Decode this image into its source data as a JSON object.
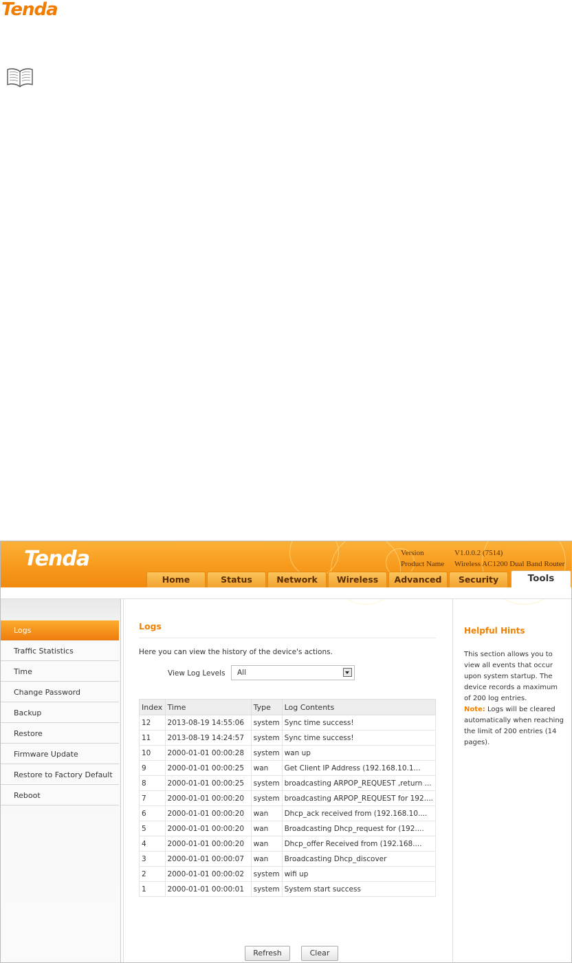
{
  "document": {
    "logo_text": "Tenda"
  },
  "app": {
    "brand": "Tenda",
    "version_label": "Version",
    "version_value": "V1.0.0.2 (7514)",
    "product_label": "Product Name",
    "product_value": "Wireless AC1200 Dual Band Router",
    "accent_color": "#f08000"
  },
  "tabs": [
    {
      "label": "Home"
    },
    {
      "label": "Status"
    },
    {
      "label": "Network"
    },
    {
      "label": "Wireless"
    },
    {
      "label": "Advanced"
    },
    {
      "label": "Security"
    },
    {
      "label": "Tools",
      "active": true
    }
  ],
  "sidebar": {
    "items": [
      {
        "label": "Logs",
        "active": true
      },
      {
        "label": "Traffic Statistics"
      },
      {
        "label": "Time"
      },
      {
        "label": "Change Password"
      },
      {
        "label": "Backup"
      },
      {
        "label": "Restore"
      },
      {
        "label": "Firmware Update"
      },
      {
        "label": "Restore to Factory Default"
      },
      {
        "label": "Reboot"
      }
    ]
  },
  "main": {
    "title": "Logs",
    "intro": "Here you can view the history of the device's actions.",
    "level_label": "View Log Levels",
    "level_value": "All",
    "columns": [
      "Index",
      "Time",
      "Type",
      "Log Contents"
    ],
    "rows": [
      [
        "12",
        "2013-08-19 14:55:06",
        "system",
        "Sync time success!"
      ],
      [
        "11",
        "2013-08-19 14:24:57",
        "system",
        "Sync time success!"
      ],
      [
        "10",
        "2000-01-01 00:00:28",
        "system",
        "wan up"
      ],
      [
        "9",
        "2000-01-01 00:00:25",
        "wan",
        "Get Client IP Address (192.168.10.1..."
      ],
      [
        "8",
        "2000-01-01 00:00:25",
        "system",
        "broadcasting ARPOP_REQUEST ,return ..."
      ],
      [
        "7",
        "2000-01-01 00:00:20",
        "system",
        "broadcasting ARPOP_REQUEST for 192...."
      ],
      [
        "6",
        "2000-01-01 00:00:20",
        "wan",
        "Dhcp_ack received from (192.168.10...."
      ],
      [
        "5",
        "2000-01-01 00:00:20",
        "wan",
        "Broadcasting Dhcp_request for (192...."
      ],
      [
        "4",
        "2000-01-01 00:00:20",
        "wan",
        "Dhcp_offer Received from (192.168...."
      ],
      [
        "3",
        "2000-01-01 00:00:07",
        "wan",
        "Broadcasting Dhcp_discover"
      ],
      [
        "2",
        "2000-01-01 00:00:02",
        "system",
        "wifi up"
      ],
      [
        "1",
        "2000-01-01 00:00:01",
        "system",
        "System start success"
      ]
    ],
    "refresh_label": "Refresh",
    "clear_label": "Clear"
  },
  "hints": {
    "title": "Helpful Hints",
    "text1": "This section allows you to view all events that occur upon system startup. The device records a maximum of 200 log entries.",
    "note_label": "Note:",
    "text2": "Logs will be cleared automatically when reaching the limit of 200 entries (14 pages)."
  },
  "icons": {
    "book": "book-icon",
    "dropdown": "chevron-down-icon"
  }
}
